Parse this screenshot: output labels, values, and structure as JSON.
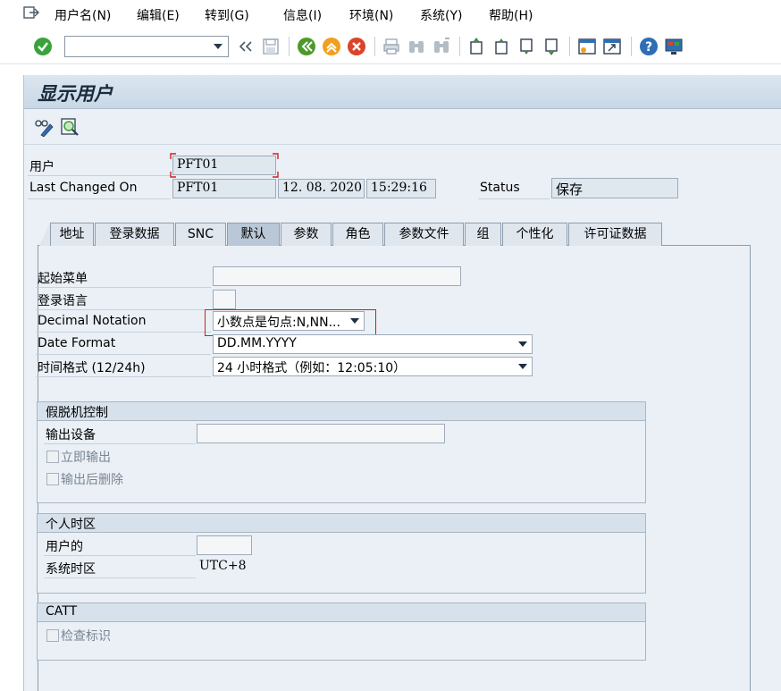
{
  "menu": {
    "items": [
      "用户名(N)",
      "编辑(E)",
      "转到(G)",
      "信息(I)",
      "环境(N)",
      "系统(Y)",
      "帮助(H)"
    ]
  },
  "toolbar": {
    "command_value": "",
    "icons": [
      "enter-icon",
      "back-icon",
      "save-icon",
      "back-green-icon",
      "exit-icon",
      "cancel-icon",
      "print-icon",
      "find-icon",
      "find-next-icon",
      "first-page-icon",
      "prev-page-icon",
      "next-page-icon",
      "last-page-icon",
      "new-session-icon",
      "shortcut-icon",
      "help-icon",
      "layout-icon"
    ],
    "colors": {
      "enter": "#3aa23a",
      "back_green": "#4c9a2a",
      "exit": "#f0a020",
      "cancel": "#d9442a",
      "help": "#2f6db5"
    }
  },
  "page": {
    "title": "显示用户"
  },
  "header": {
    "user_label": "用户",
    "user_value": "PFT01",
    "last_changed_label": "Last Changed On",
    "last_changed_user": "PFT01",
    "last_changed_date": "12. 08. 2020",
    "last_changed_time": "15:29:16",
    "status_label": "Status",
    "status_value": "保存"
  },
  "tabs": [
    {
      "label": "地址",
      "active": false
    },
    {
      "label": "登录数据",
      "active": false
    },
    {
      "label": "SNC",
      "active": false
    },
    {
      "label": "默认",
      "active": true
    },
    {
      "label": "参数",
      "active": false
    },
    {
      "label": "角色",
      "active": false
    },
    {
      "label": "参数文件",
      "active": false
    },
    {
      "label": "组",
      "active": false
    },
    {
      "label": "个性化",
      "active": false
    },
    {
      "label": "许可证数据",
      "active": false
    }
  ],
  "defaults": {
    "start_menu_label": "起始菜单",
    "start_menu_value": "",
    "logon_language_label": "登录语言",
    "logon_language_value": "",
    "decimal_notation_label": "Decimal Notation",
    "decimal_notation_value": "小数点是句点:N,NN...",
    "date_format_label": "Date Format",
    "date_format_value": "DD.MM.YYYY",
    "time_format_label": "时间格式 (12/24h)",
    "time_format_value": "24 小时格式（例如：12:05:10）"
  },
  "spool": {
    "title": "假脱机控制",
    "output_device_label": "输出设备",
    "output_device_value": "",
    "print_immediately_label": "立即输出",
    "print_immediately_checked": false,
    "delete_after_output_label": "输出后删除",
    "delete_after_output_checked": false
  },
  "timezone": {
    "title": "个人时区",
    "user_tz_label": "用户的",
    "user_tz_value": "",
    "system_tz_label": "系统时区",
    "system_tz_value": "UTC+8"
  },
  "catt": {
    "title": "CATT",
    "check_flag_label": "检查标识",
    "check_flag_checked": false
  }
}
